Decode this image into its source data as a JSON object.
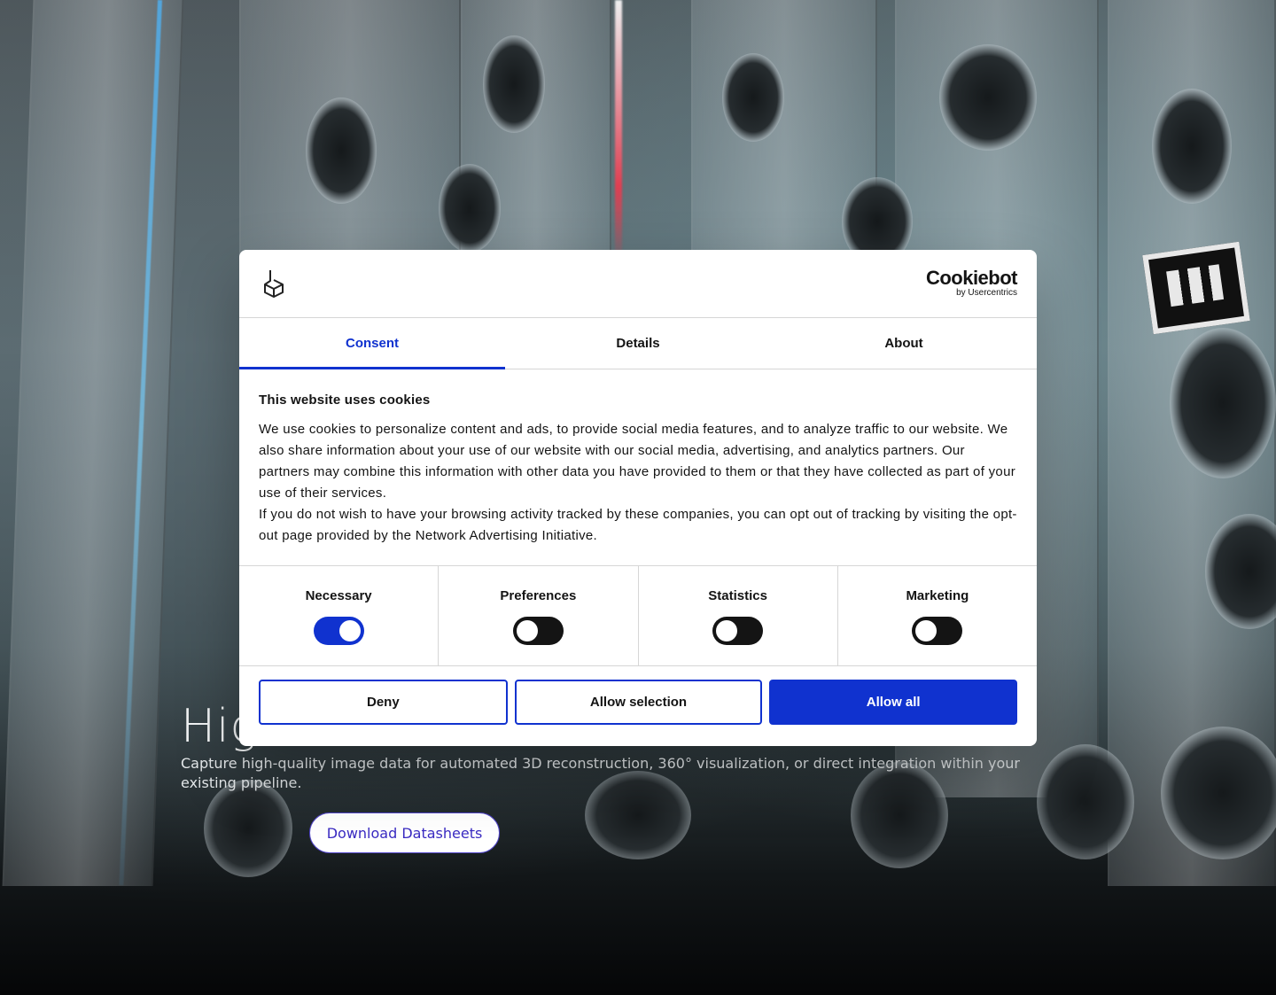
{
  "hero": {
    "title": "Hig",
    "subtitle": "Capture high-quality image data for automated 3D reconstruction, 360° visualization, or direct integration within your existing pipeline.",
    "cta_label": "Download Datasheets"
  },
  "dialog": {
    "brand": {
      "name": "Cookiebot",
      "byline": "by Usercentrics"
    },
    "tabs": [
      {
        "label": "Consent",
        "active": true
      },
      {
        "label": "Details",
        "active": false
      },
      {
        "label": "About",
        "active": false
      }
    ],
    "heading": "This website uses cookies",
    "paragraphs": [
      "We use cookies to personalize content and ads, to provide social media features, and to analyze traffic to our website. We also share information about your use of our website with our social media, advertising, and analytics partners. Our partners may combine this information with other data you have provided to them or that they have collected as part of your use of their services.",
      "If you do not wish to have your browsing activity tracked by these companies, you can opt out of tracking by visiting the opt-out page provided by the Network Advertising Initiative."
    ],
    "categories": [
      {
        "label": "Necessary",
        "on": true
      },
      {
        "label": "Preferences",
        "on": false
      },
      {
        "label": "Statistics",
        "on": false
      },
      {
        "label": "Marketing",
        "on": false
      }
    ],
    "buttons": {
      "deny": "Deny",
      "allow_selection": "Allow selection",
      "allow_all": "Allow all"
    }
  },
  "colors": {
    "accent": "#1032cf",
    "cta_text": "#3a2bc2",
    "switch_off": "#141414"
  }
}
